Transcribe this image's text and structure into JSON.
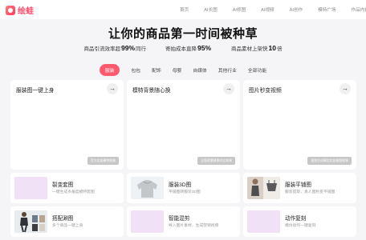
{
  "brand": {
    "name": "绘蛙"
  },
  "nav": [
    "首页",
    "AI长图",
    "AI修图",
    "AI视频",
    "AI创作",
    "模特广场",
    "作品内嵌材"
  ],
  "hero": {
    "title": "让你的商品第一时间被种草",
    "stats": [
      {
        "prefix": "商品引流效率超",
        "value": "99%",
        "suffix": "同行"
      },
      {
        "prefix": "寄拍成本直降",
        "value": "95%",
        "suffix": ""
      },
      {
        "prefix": "商品素材上架快",
        "value": "10",
        "suffix": "倍"
      }
    ]
  },
  "tabs": [
    "服装",
    "包包",
    "配饰",
    "母婴",
    "自媒体",
    "其他行业",
    "全部功能"
  ],
  "feature_cards": [
    {
      "title": "服装图一键上身",
      "tag": "官方实拍模特效果"
    },
    {
      "title": "模特背景随心换",
      "tag": "全图背景替换对比效果"
    },
    {
      "title": "图片秒变视频",
      "tag": "视频生成模型实拍视频效果"
    }
  ],
  "tools": [
    {
      "title": "裂变套图",
      "subtitle": "一键生成多角度模特套图"
    },
    {
      "title": "服装3D图",
      "subtitle": "平铺图转服装3D图"
    },
    {
      "title": "服装平铺图",
      "subtitle": "服装提取，真人图秒变平铺图"
    },
    {
      "title": "搭配涮图",
      "subtitle": "多个单品一键上身"
    },
    {
      "title": "智能混剪",
      "subtitle": "导入图片素材，生成营销视频"
    },
    {
      "title": "动作复刻",
      "subtitle": "模仿动作一键复刻"
    }
  ],
  "icons": {
    "arrow": "arrow-right-icon"
  },
  "colors": {
    "accent": "#ff5a6e",
    "thumb_pink": "#f1e1f7"
  }
}
